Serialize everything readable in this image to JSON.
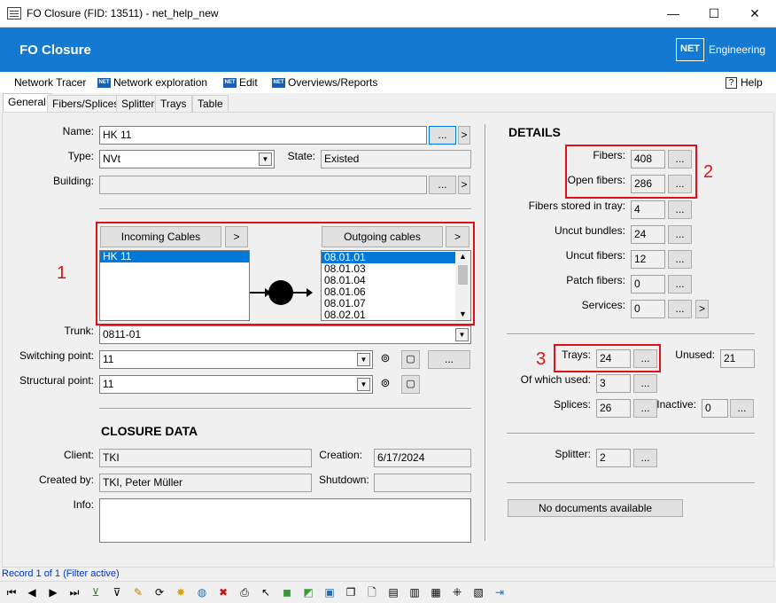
{
  "window": {
    "title": "FO Closure (FID: 13511) - net_help_new",
    "minimize": "—",
    "maximize": "☐",
    "close": "✕"
  },
  "header": {
    "title": "FO Closure",
    "logo_box": "NET",
    "logo_text": "Engineering",
    "accent": "#1379d1"
  },
  "menu": {
    "items": [
      {
        "label": "Network Tracer",
        "icon": ""
      },
      {
        "label": "Network exploration",
        "icon": "net-icon"
      },
      {
        "label": "Edit",
        "icon": "net-icon"
      },
      {
        "label": "Overviews/Reports",
        "icon": "net-icon"
      }
    ],
    "help": "Help",
    "net_tag": "NET"
  },
  "tabs": [
    "General",
    "Fibers/Splices",
    "Splitter",
    "Trays",
    "Table"
  ],
  "form": {
    "name_label": "Name:",
    "name_value": "HK 11",
    "type_label": "Type:",
    "type_value": "NVt",
    "state_label": "State:",
    "state_value": "Existed",
    "building_label": "Building:",
    "building_value": "",
    "dots": "...",
    "arrow": ">",
    "incoming_label": "Incoming Cables",
    "outgoing_label": "Outgoing cables",
    "incoming_items": [
      "HK 11"
    ],
    "outgoing_items": [
      "08.01.01",
      "08.01.03",
      "08.01.04",
      "08.01.06",
      "08.01.07",
      "08.02.01"
    ],
    "trunk_label": "Trunk:",
    "trunk_value": "0811-01",
    "switching_label": "Switching point:",
    "switching_value": "11",
    "structural_label": "Structural point:",
    "structural_value": "11"
  },
  "closure": {
    "title": "CLOSURE DATA",
    "client_label": "Client:",
    "client_value": "TKI",
    "creation_label": "Creation:",
    "creation_value": "6/17/2024",
    "createdby_label": "Created by:",
    "createdby_value": "TKI, Peter Müller",
    "shutdown_label": "Shutdown:",
    "shutdown_value": "",
    "info_label": "Info:",
    "info_value": ""
  },
  "details": {
    "title": "DETAILS",
    "fibers_label": "Fibers:",
    "fibers_value": "408",
    "open_label": "Open fibers:",
    "open_value": "286",
    "stored_label": "Fibers stored in tray:",
    "stored_value": "4",
    "uncut_bundles_label": "Uncut bundles:",
    "uncut_bundles_value": "24",
    "uncut_fibers_label": "Uncut fibers:",
    "uncut_fibers_value": "12",
    "patch_label": "Patch fibers:",
    "patch_value": "0",
    "services_label": "Services:",
    "services_value": "0",
    "trays_label": "Trays:",
    "trays_value": "24",
    "unused_label": "Unused:",
    "unused_value": "21",
    "used_label": "Of which used:",
    "used_value": "3",
    "splices_label": "Splices:",
    "splices_value": "26",
    "inactive_label": "Inactive:",
    "inactive_value": "0",
    "splitter_label": "Splitter:",
    "splitter_value": "2",
    "docs_label": "No documents available"
  },
  "annotations": {
    "n1": "1",
    "n2": "2",
    "n3": "3",
    "color": "#e0101a"
  },
  "status": {
    "record": "Record 1 of 1 (Filter active)"
  }
}
